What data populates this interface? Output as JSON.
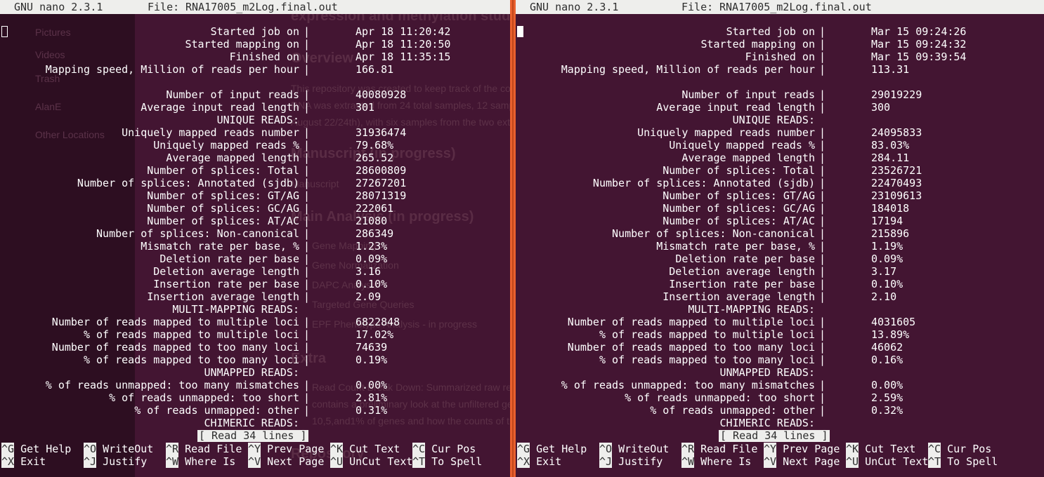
{
  "app": {
    "name": "GNU nano 2.3.1",
    "file_prefix": "File: ",
    "filename": "RNA17005_m2Log.final.out"
  },
  "ghost": {
    "sidebar": [
      "Pictures",
      "Videos",
      "Trash",
      "AlanE",
      "Other Locations"
    ],
    "heading1": "expression and methylation study",
    "heading2": "Overview",
    "para": [
      "This repository was created to keep track of the code and preliminary analyses for the 2017 Oyster Acidification Experiment.",
      "RNA was extracted from 24 total samples, 12 samples from Timepoint 3 (Day 9) and 12 samples from Timepoint 6 (Day",
      "August 22/24th), with six samples from the two extreme treatments (400 and 2800 ppm) within each timepoints."
    ],
    "heading3": "Manuscript (in progress)",
    "manuscript": "Manuscript",
    "heading4": "Main Analysis (in progress)",
    "analysis": [
      "Gene Mapping",
      "Gene Normalization",
      "DAPC Analysis",
      "Targeted Gene Queries",
      "EPF Phenotype Analysis - in progress"
    ],
    "heading5": "Extra",
    "extra": [
      "Read Count Break Down: Summarized raw read, trimmed and mapped read counts per individual. This file",
      "contains a preliminary look at the unfiltered  genecount  matrix. Specifically, looking how many genes fall in the",
      "10,5,and1% of genes and how the counts of those genes compare between treatments."
    ],
    "heading6": "Repository"
  },
  "labels": [
    "Started job on",
    "Started mapping on",
    "Finished on",
    "Mapping speed, Million of reads per hour",
    "",
    "Number of input reads",
    "Average input read length",
    "UNIQUE READS:",
    "Uniquely mapped reads number",
    "Uniquely mapped reads %",
    "Average mapped length",
    "Number of splices: Total",
    "Number of splices: Annotated (sjdb)",
    "Number of splices: GT/AG",
    "Number of splices: GC/AG",
    "Number of splices: AT/AC",
    "Number of splices: Non-canonical",
    "Mismatch rate per base, %",
    "Deletion rate per base",
    "Deletion average length",
    "Insertion rate per base",
    "Insertion average length",
    "MULTI-MAPPING READS:",
    "Number of reads mapped to multiple loci",
    "% of reads mapped to multiple loci",
    "Number of reads mapped to too many loci",
    "% of reads mapped to too many loci",
    "UNMAPPED READS:",
    "% of reads unmapped: too many mismatches",
    "% of reads unmapped: too short",
    "% of reads unmapped: other",
    "CHIMERIC READS:"
  ],
  "panes": [
    {
      "values": [
        "Apr 18 11:20:42",
        "Apr 18 11:20:50",
        "Apr 18 11:35:15",
        "166.81",
        "",
        "40080928",
        "301",
        "",
        "31936474",
        "79.68%",
        "265.52",
        "28600809",
        "27267201",
        "28071319",
        "222061",
        "21080",
        "286349",
        "1.23%",
        "0.09%",
        "3.16",
        "0.10%",
        "2.09",
        "",
        "6822848",
        "17.02%",
        "74639",
        "0.19%",
        "",
        "0.00%",
        "2.81%",
        "0.31%",
        ""
      ]
    },
    {
      "values": [
        "Mar 15 09:24:26",
        "Mar 15 09:24:32",
        "Mar 15 09:39:54",
        "113.31",
        "",
        "29019229",
        "300",
        "",
        "24095833",
        "83.03%",
        "284.11",
        "23526721",
        "22470493",
        "23109613",
        "184018",
        "17194",
        "215896",
        "1.19%",
        "0.09%",
        "3.17",
        "0.10%",
        "2.10",
        "",
        "4031605",
        "13.89%",
        "46062",
        "0.16%",
        "",
        "0.00%",
        "2.59%",
        "0.32%",
        ""
      ]
    }
  ],
  "status": "[ Read 34 lines ]",
  "shortcuts": [
    [
      {
        "key": "^G",
        "label": "Get Help"
      },
      {
        "key": "^X",
        "label": "Exit"
      }
    ],
    [
      {
        "key": "^O",
        "label": "WriteOut"
      },
      {
        "key": "^J",
        "label": "Justify"
      }
    ],
    [
      {
        "key": "^R",
        "label": "Read File"
      },
      {
        "key": "^W",
        "label": "Where Is"
      }
    ],
    [
      {
        "key": "^Y",
        "label": "Prev Page"
      },
      {
        "key": "^V",
        "label": "Next Page"
      }
    ],
    [
      {
        "key": "^K",
        "label": "Cut Text"
      },
      {
        "key": "^U",
        "label": "UnCut Text"
      }
    ],
    [
      {
        "key": "^C",
        "label": "Cur Pos"
      },
      {
        "key": "^T",
        "label": "To Spell"
      }
    ]
  ],
  "colors": {
    "terminal_bg": "#431532",
    "divider": "#e9602e",
    "bar_bg": "#eeeeec",
    "text": "#ffffff"
  }
}
